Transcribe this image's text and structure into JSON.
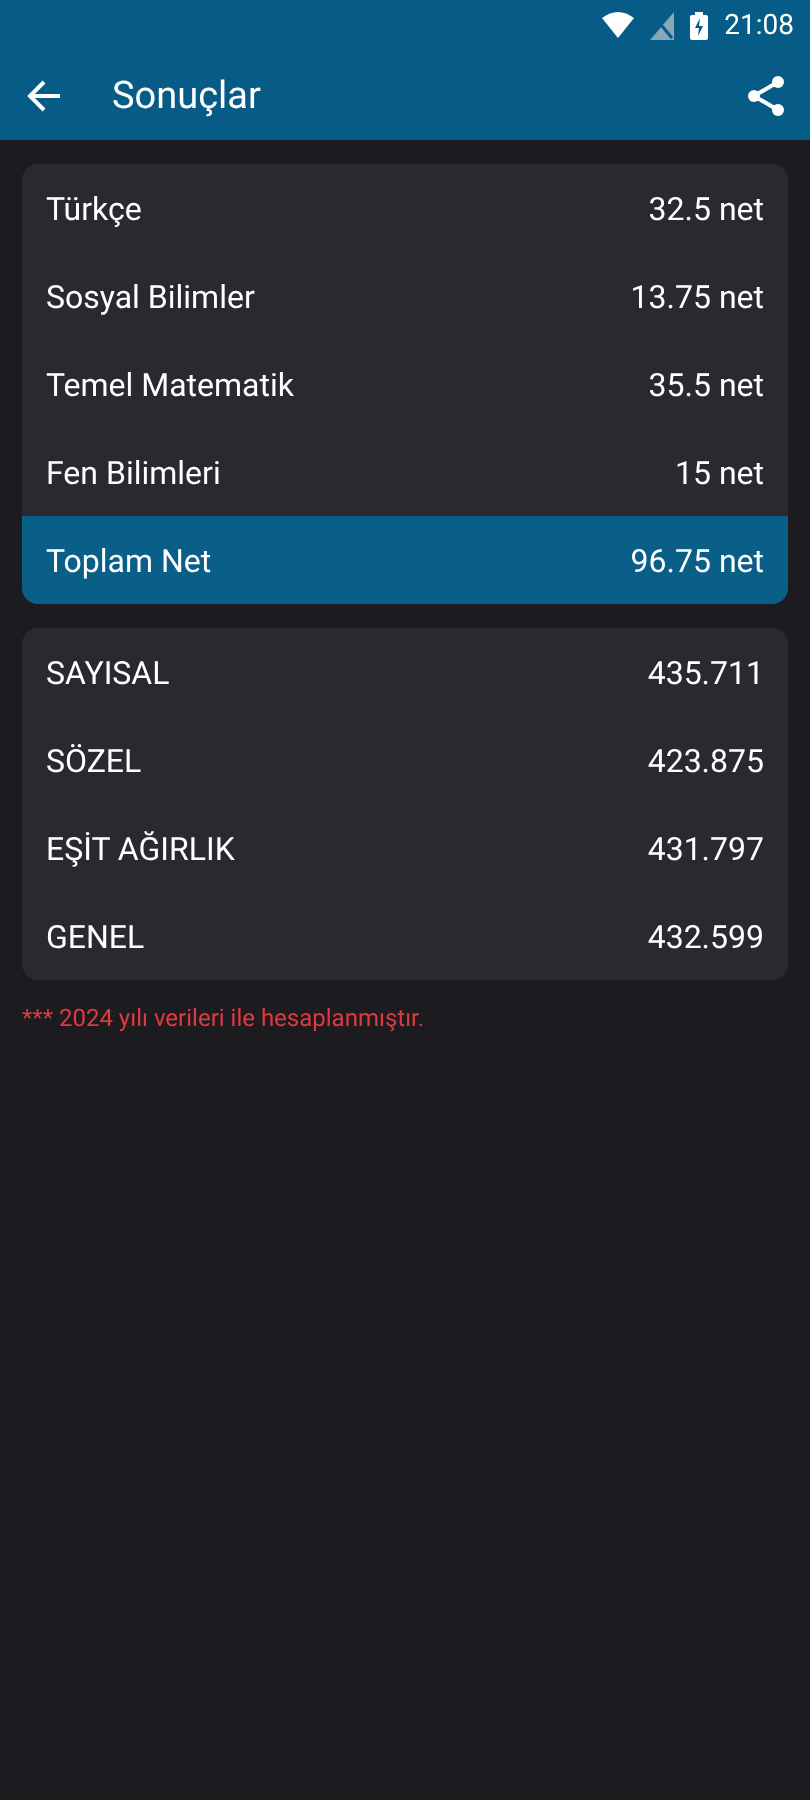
{
  "status_bar": {
    "time": "21:08"
  },
  "app_bar": {
    "title": "Sonuçlar"
  },
  "net_card": {
    "rows": [
      {
        "label": "Türkçe",
        "value": "32.5 net",
        "highlighted": false
      },
      {
        "label": "Sosyal Bilimler",
        "value": "13.75 net",
        "highlighted": false
      },
      {
        "label": "Temel Matematik",
        "value": "35.5 net",
        "highlighted": false
      },
      {
        "label": "Fen Bilimleri",
        "value": "15 net",
        "highlighted": false
      },
      {
        "label": "Toplam Net",
        "value": "96.75 net",
        "highlighted": true
      }
    ]
  },
  "score_card": {
    "rows": [
      {
        "label": "SAYISAL",
        "value": "435.711"
      },
      {
        "label": "SÖZEL",
        "value": "423.875"
      },
      {
        "label": "EŞİT AĞIRLIK",
        "value": "431.797"
      },
      {
        "label": "GENEL",
        "value": "432.599"
      }
    ]
  },
  "note": "*** 2024 yılı verileri ile hesaplanmıştır."
}
